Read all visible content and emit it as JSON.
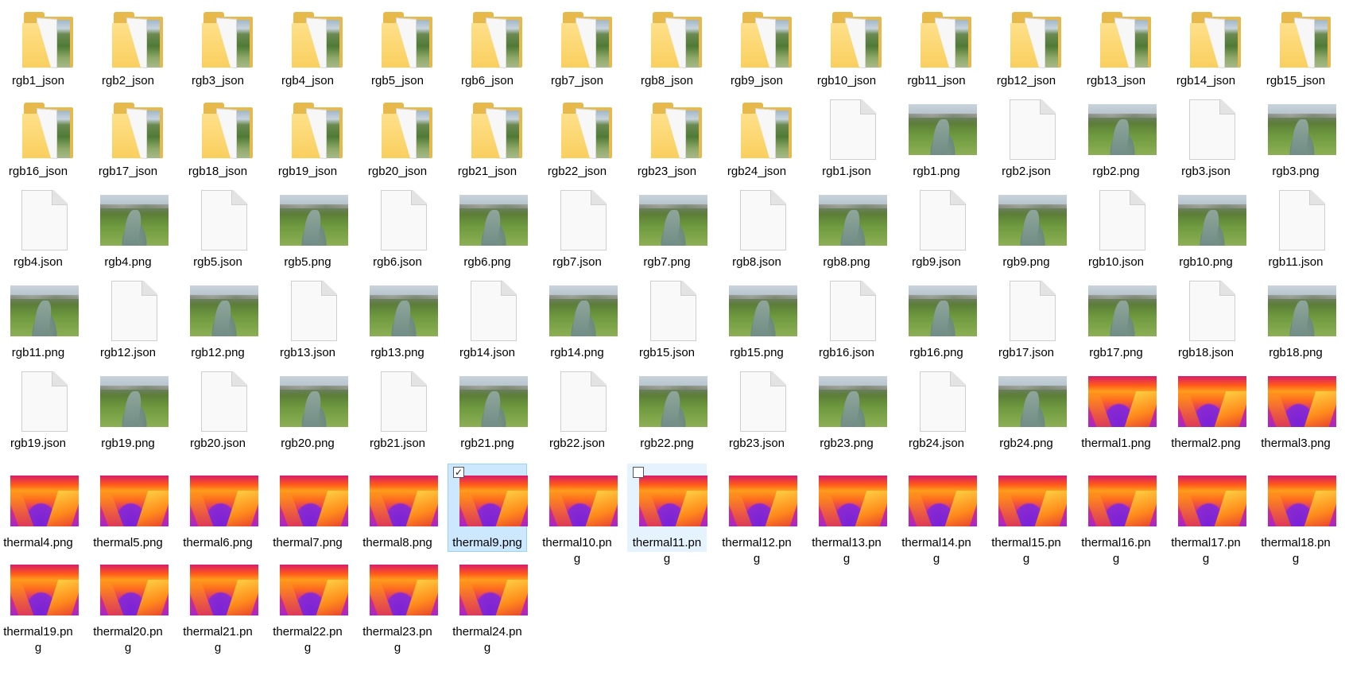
{
  "window": {
    "selected_item": "thermal9.png",
    "hovered_item": "thermal11.png"
  },
  "items": [
    {
      "name": "rgb1_json",
      "type": "folder"
    },
    {
      "name": "rgb2_json",
      "type": "folder"
    },
    {
      "name": "rgb3_json",
      "type": "folder"
    },
    {
      "name": "rgb4_json",
      "type": "folder"
    },
    {
      "name": "rgb5_json",
      "type": "folder"
    },
    {
      "name": "rgb6_json",
      "type": "folder"
    },
    {
      "name": "rgb7_json",
      "type": "folder"
    },
    {
      "name": "rgb8_json",
      "type": "folder"
    },
    {
      "name": "rgb9_json",
      "type": "folder"
    },
    {
      "name": "rgb10_json",
      "type": "folder"
    },
    {
      "name": "rgb11_json",
      "type": "folder"
    },
    {
      "name": "rgb12_json",
      "type": "folder"
    },
    {
      "name": "rgb13_json",
      "type": "folder"
    },
    {
      "name": "rgb14_json",
      "type": "folder"
    },
    {
      "name": "rgb15_json",
      "type": "folder"
    },
    {
      "name": "rgb16_json",
      "type": "folder"
    },
    {
      "name": "rgb17_json",
      "type": "folder"
    },
    {
      "name": "rgb18_json",
      "type": "folder"
    },
    {
      "name": "rgb19_json",
      "type": "folder"
    },
    {
      "name": "rgb20_json",
      "type": "folder"
    },
    {
      "name": "rgb21_json",
      "type": "folder"
    },
    {
      "name": "rgb22_json",
      "type": "folder"
    },
    {
      "name": "rgb23_json",
      "type": "folder"
    },
    {
      "name": "rgb24_json",
      "type": "folder"
    },
    {
      "name": "rgb1.json",
      "type": "doc"
    },
    {
      "name": "rgb1.png",
      "type": "photo"
    },
    {
      "name": "rgb2.json",
      "type": "doc"
    },
    {
      "name": "rgb2.png",
      "type": "photo"
    },
    {
      "name": "rgb3.json",
      "type": "doc"
    },
    {
      "name": "rgb3.png",
      "type": "photo"
    },
    {
      "name": "rgb4.json",
      "type": "doc"
    },
    {
      "name": "rgb4.png",
      "type": "photo"
    },
    {
      "name": "rgb5.json",
      "type": "doc"
    },
    {
      "name": "rgb5.png",
      "type": "photo"
    },
    {
      "name": "rgb6.json",
      "type": "doc"
    },
    {
      "name": "rgb6.png",
      "type": "photo"
    },
    {
      "name": "rgb7.json",
      "type": "doc"
    },
    {
      "name": "rgb7.png",
      "type": "photo"
    },
    {
      "name": "rgb8.json",
      "type": "doc"
    },
    {
      "name": "rgb8.png",
      "type": "photo"
    },
    {
      "name": "rgb9.json",
      "type": "doc"
    },
    {
      "name": "rgb9.png",
      "type": "photo"
    },
    {
      "name": "rgb10.json",
      "type": "doc"
    },
    {
      "name": "rgb10.png",
      "type": "photo"
    },
    {
      "name": "rgb11.json",
      "type": "doc"
    },
    {
      "name": "rgb11.png",
      "type": "photo"
    },
    {
      "name": "rgb12.json",
      "type": "doc"
    },
    {
      "name": "rgb12.png",
      "type": "photo"
    },
    {
      "name": "rgb13.json",
      "type": "doc"
    },
    {
      "name": "rgb13.png",
      "type": "photo"
    },
    {
      "name": "rgb14.json",
      "type": "doc"
    },
    {
      "name": "rgb14.png",
      "type": "photo"
    },
    {
      "name": "rgb15.json",
      "type": "doc"
    },
    {
      "name": "rgb15.png",
      "type": "photo"
    },
    {
      "name": "rgb16.json",
      "type": "doc"
    },
    {
      "name": "rgb16.png",
      "type": "photo"
    },
    {
      "name": "rgb17.json",
      "type": "doc"
    },
    {
      "name": "rgb17.png",
      "type": "photo"
    },
    {
      "name": "rgb18.json",
      "type": "doc"
    },
    {
      "name": "rgb18.png",
      "type": "photo"
    },
    {
      "name": "rgb19.json",
      "type": "doc"
    },
    {
      "name": "rgb19.png",
      "type": "photo"
    },
    {
      "name": "rgb20.json",
      "type": "doc"
    },
    {
      "name": "rgb20.png",
      "type": "photo"
    },
    {
      "name": "rgb21.json",
      "type": "doc"
    },
    {
      "name": "rgb21.png",
      "type": "photo"
    },
    {
      "name": "rgb22.json",
      "type": "doc"
    },
    {
      "name": "rgb22.png",
      "type": "photo"
    },
    {
      "name": "rgb23.json",
      "type": "doc"
    },
    {
      "name": "rgb23.png",
      "type": "photo"
    },
    {
      "name": "rgb24.json",
      "type": "doc"
    },
    {
      "name": "rgb24.png",
      "type": "photo"
    },
    {
      "name": "thermal1.png",
      "type": "thermal"
    },
    {
      "name": "thermal2.png",
      "type": "thermal"
    },
    {
      "name": "thermal3.png",
      "type": "thermal"
    },
    {
      "name": "thermal4.png",
      "type": "thermal"
    },
    {
      "name": "thermal5.png",
      "type": "thermal"
    },
    {
      "name": "thermal6.png",
      "type": "thermal"
    },
    {
      "name": "thermal7.png",
      "type": "thermal"
    },
    {
      "name": "thermal8.png",
      "type": "thermal"
    },
    {
      "name": "thermal9.png",
      "type": "thermal",
      "selected": true
    },
    {
      "name": "thermal10.png",
      "type": "thermal"
    },
    {
      "name": "thermal11.png",
      "type": "thermal",
      "hovered": true
    },
    {
      "name": "thermal12.png",
      "type": "thermal"
    },
    {
      "name": "thermal13.png",
      "type": "thermal"
    },
    {
      "name": "thermal14.png",
      "type": "thermal"
    },
    {
      "name": "thermal15.png",
      "type": "thermal"
    },
    {
      "name": "thermal16.png",
      "type": "thermal"
    },
    {
      "name": "thermal17.png",
      "type": "thermal"
    },
    {
      "name": "thermal18.png",
      "type": "thermal"
    },
    {
      "name": "thermal19.png",
      "type": "thermal"
    },
    {
      "name": "thermal20.png",
      "type": "thermal"
    },
    {
      "name": "thermal21.png",
      "type": "thermal"
    },
    {
      "name": "thermal22.png",
      "type": "thermal"
    },
    {
      "name": "thermal23.png",
      "type": "thermal"
    },
    {
      "name": "thermal24.png",
      "type": "thermal"
    }
  ],
  "icons": {
    "folder": "folder-icon",
    "doc": "json-file-icon",
    "photo": "image-thumbnail-icon",
    "thermal": "thermal-image-thumbnail-icon"
  },
  "colors": {
    "selection": "#cce8ff",
    "selection_border": "#99d1ff",
    "hover": "#e5f3ff"
  }
}
